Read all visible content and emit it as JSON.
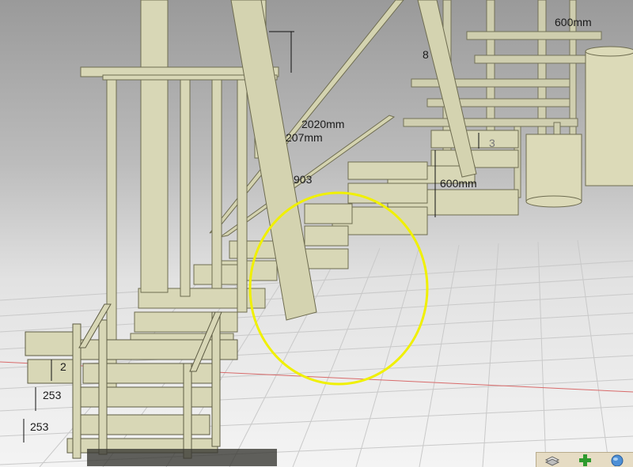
{
  "viewport": {
    "dimensions": {
      "top_left_600": "600mm",
      "top_left_8": "8",
      "stringer_2020": "2020mm",
      "stringer_207": "207mm",
      "landing_903": "903",
      "landing_600": "600mm",
      "step_3": "3",
      "bottom_2": "2",
      "bottom_253_a": "253",
      "bottom_253_b": "253"
    },
    "highlight_color": "#f0f000",
    "structure_color": "#d8d7b6",
    "toolbar": {
      "icons": [
        "layers-icon",
        "add-icon",
        "globe-icon"
      ]
    }
  }
}
